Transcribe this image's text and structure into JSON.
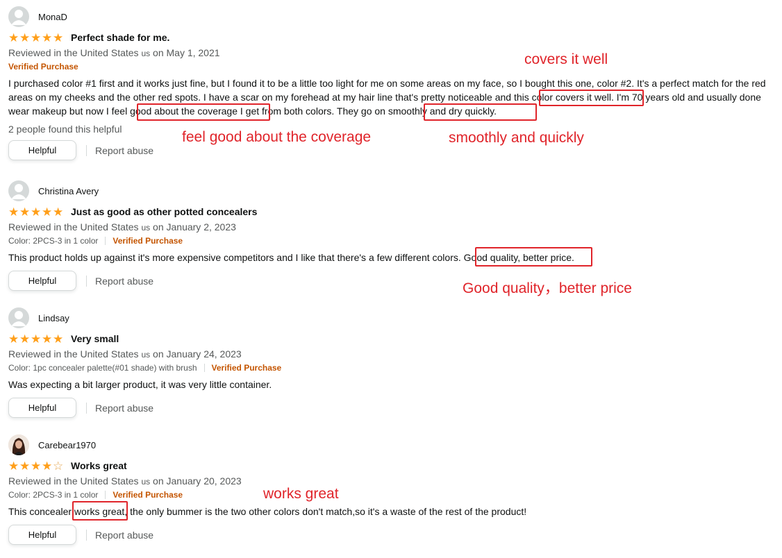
{
  "reviews": [
    {
      "reviewer": "MonaD",
      "rating": 5,
      "title": "Perfect shade for me.",
      "reviewed_prefix": "Reviewed in the United States",
      "country_code": "us",
      "date": "on May 1, 2021",
      "verified": "Verified Purchase",
      "body": "I purchased color #1 first and it works just fine, but I found it to be a little too light for me on some areas on my face, so I bought this one, color #2. It's a perfect match for the red areas on my cheeks and the other red spots. I have a scar on my forehead at my hair line that's pretty noticeable and this color covers it well. I'm 70 years old and usually done wear makeup but now I feel good about the coverage I get from both colors. They go on smoothly and dry quickly.",
      "helpful_count": "2 people found this helpful",
      "helpful_button": "Helpful",
      "report": "Report abuse"
    },
    {
      "reviewer": "Christina Avery",
      "rating": 5,
      "title": "Just as good as other potted concealers",
      "reviewed_prefix": "Reviewed in the United States",
      "country_code": "us",
      "date": "on January 2, 2023",
      "color": "Color: 2PCS-3 in 1 color",
      "verified": "Verified Purchase",
      "body": "This product holds up against it's more expensive competitors and I like that there's a few different colors. Good quality, better price.",
      "helpful_button": "Helpful",
      "report": "Report abuse"
    },
    {
      "reviewer": "Lindsay",
      "rating": 5,
      "title": "Very small",
      "reviewed_prefix": "Reviewed in the United States",
      "country_code": "us",
      "date": "on January 24, 2023",
      "color": "Color: 1pc concealer palette(#01 shade) with brush",
      "verified": "Verified Purchase",
      "body": "Was expecting a bit larger product, it was very little container.",
      "helpful_button": "Helpful",
      "report": "Report abuse"
    },
    {
      "reviewer": "Carebear1970",
      "rating": 4,
      "title": "Works great",
      "reviewed_prefix": "Reviewed in the United States",
      "country_code": "us",
      "date": "on January 20, 2023",
      "color": "Color: 2PCS-3 in 1 color",
      "verified": "Verified Purchase",
      "body": "This concealer works great, the only bummer is the two other colors don't match,so it's a waste of the rest of the product!",
      "helpful_button": "Helpful",
      "report": "Report abuse"
    }
  ],
  "annotations": {
    "covers": "covers it well",
    "coverage": "feel good about the coverage",
    "smoothly": "smoothly and quickly",
    "quality": "Good quality，better price",
    "works": "works great"
  },
  "colors": {
    "star": "#ff9f1a",
    "verified": "#c45500",
    "annotation": "#e0242a"
  }
}
